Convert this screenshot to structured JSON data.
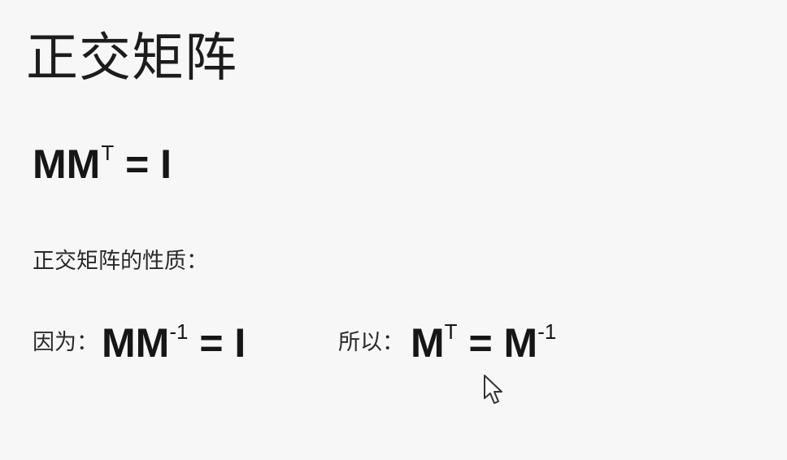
{
  "slide": {
    "title": "正交矩阵",
    "definition": {
      "base": "MM",
      "sup": "T",
      "rest": " = I"
    },
    "properties_label": "正交矩阵的性质：",
    "because": {
      "label": "因为：",
      "base": "MM",
      "sup": "-1",
      "rest": " = I"
    },
    "therefore": {
      "label": "所以：",
      "base": "M",
      "sup": "T",
      "rest": " = M",
      "sup2": "-1"
    }
  },
  "icons": {
    "cursor": "mouse-pointer-icon"
  }
}
